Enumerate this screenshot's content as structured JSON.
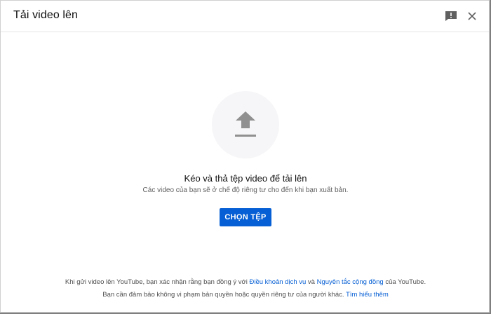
{
  "dialog": {
    "title": "Tải video lên",
    "feedback_icon": "feedback-icon",
    "close_icon": "close-icon"
  },
  "upload": {
    "icon": "upload-arrow-icon",
    "drag_text": "Kéo và thả tệp video để tải lên",
    "privacy_note": "Các video của bạn sẽ ở chế độ riêng tư cho đến khi bạn xuất bản.",
    "select_button": "CHỌN TỆP"
  },
  "footer": {
    "line1_prefix": "Khi gửi video lên YouTube, bạn xác nhận rằng bạn đồng ý với ",
    "terms_link": "Điều khoản dịch vụ",
    "line1_and": " và ",
    "guidelines_link": "Nguyên tắc cộng đồng",
    "line1_suffix": " của YouTube.",
    "line2_prefix": "Bạn cần đảm bảo không vi phạm bản quyền hoặc quyền riêng tư của người khác. ",
    "learn_more_link": "Tìm hiểu thêm"
  },
  "colors": {
    "accent": "#065fd4",
    "icon_gray": "#909090",
    "circle_bg": "#f6f5f7"
  }
}
